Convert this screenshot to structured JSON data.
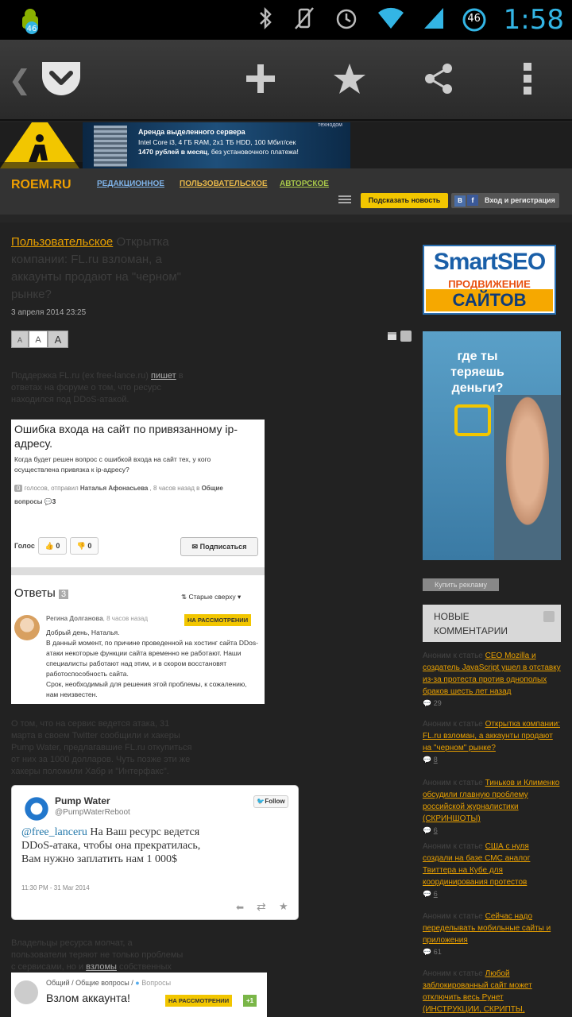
{
  "status_bar": {
    "time": "1:58",
    "battery_level": "46",
    "notification_badge": "46",
    "icons": [
      "android-notification-icon",
      "bluetooth-icon",
      "vibrate-off-icon",
      "alarm-icon",
      "wifi-icon",
      "signal-icon",
      "battery-icon"
    ]
  },
  "action_bar": {
    "icons": [
      "back-chevron-icon",
      "pocket-logo-icon",
      "add-icon",
      "star-icon",
      "share-icon",
      "overflow-menu-icon"
    ]
  },
  "ad_banner": {
    "brand": "технодом",
    "line1": "Аренда выделенного сервера",
    "line2": "Intel Core i3, 4 ГБ RAM, 2x1 ТБ HDD, 100 Мбит/сек",
    "line3_bold": "1470 рублей в месяц",
    "line3_rest": ", без установочного платежа!"
  },
  "site_header": {
    "logo": "ROEM.RU",
    "nav": [
      "РЕДАКЦИОННОЕ",
      "ПОЛЬЗОВАТЕЛЬСКОЕ",
      "АВТОРСКОЕ"
    ],
    "suggest_button": "Подсказать новость",
    "login_button": "Вход и регистрация",
    "vk": "В",
    "fb": "f"
  },
  "article": {
    "category": "Пользовательское",
    "title": "Открытка компании: FL.ru взломан, а аккаунты продают на \"черном\" рынке?",
    "date": "3 апреля 2014 23:25",
    "font_sizes": [
      "A",
      "A",
      "A"
    ],
    "para1_a": "Поддержка FL.ru (ex free-lance.ru) ",
    "para1_link": "пишет",
    "para1_b": " в ответах на форуме о том, что ресурс находился под DDoS-атакой.",
    "para2": "О том, что на сервис ведется атака, 31 марта в своем Twitter сообщили и хакеры Pump Water, предлагавшие FL.ru откупиться от них за 1000 долларов. Чуть позже эти же хакеры положили Хабр и \"Интерфакс\".",
    "para3_a": "Владельцы ресурса молчат, а пользователи теряют не только проблемы с сервисами, но и ",
    "para3_link": "взломы",
    "para3_b": " собственных аккаунтов"
  },
  "forum_card": {
    "question_title": "Ошибка входа на сайт по привязанному ip-адресу.",
    "question_body": "Когда будет решен вопрос с ошибкой входа на сайт тех, у кого осуществлена привязка к ip-адресу?",
    "votes": "0",
    "meta_a": " голосов, отправил ",
    "author": "Наталья Афонасьева",
    "meta_b": " , 8 часов назад в ",
    "category": "Общие вопросы",
    "comments": "3",
    "vote_label": "Голос",
    "up_count": "0",
    "down_count": "0",
    "subscribe_button": "Подписаться",
    "answers_label": "Ответы",
    "answers_count": "3",
    "sort_label": "Старые сверху",
    "reply_author": "Регина Долганова",
    "reply_time": ", 8 часов назад",
    "reply_badge": "НА РАССМОТРЕНИИ",
    "reply_text": "Добрый день, Наталья.\nВ данный момент, по причине проведенной на хостинг сайта DDos-атаки некоторые функции сайта временно не работают. Наши специалисты работают над этим, и в скором восстановят работоспособность сайта.\nСрок, необходимый для решения этой проблемы, к сожалению, нам неизвестен."
  },
  "tweet": {
    "name": "Pump Water",
    "handle": "@PumpWaterReboot",
    "follow": "Follow",
    "mention": "@free_lanceru",
    "text": " На Ваш ресурс ведется DDoS-атака, чтобы она прекратилась, Вам нужно заплатить нам 1 000$",
    "time": "11:30 PM - 31 Mar 2014"
  },
  "forum_card2": {
    "crumb1": "Общий",
    "crumb2": "Общие вопросы",
    "crumb3": "Вопросы",
    "title": "Взлом аккаунта!",
    "badge": "НА РАССМОТРЕНИИ",
    "plus": "+1"
  },
  "sidebar": {
    "ad1_line1": "SmartSEO",
    "ad1_line2": "ПРОДВИЖЕНИЕ",
    "ad1_line3": "САЙТОВ",
    "ad2_text": "где ты теряешь деньги?",
    "buy_ad": "Купить рекламу",
    "comments_header": "НОВЫЕ КОММЕНТАРИИ",
    "comments": [
      {
        "author": "Аноним",
        "prefix": " к статье ",
        "title": "CEO Mozilla и создатель JavaScript ушел в отставку из-за протеста против однополых браков шесть лет назад",
        "count": "29"
      },
      {
        "author": "Аноним",
        "prefix": " к статье ",
        "title": "Открытка компании: FL.ru взломан, а аккаунты продают на \"черном\" рынке?",
        "count": "8"
      },
      {
        "author": "Аноним",
        "prefix": " к статье ",
        "title": "Тиньков и Клименко обсудили главную проблему российской журналистики (СКРИНШОТЫ)",
        "count": "6"
      },
      {
        "author": "Аноним",
        "prefix": " к статье ",
        "title": "США с нуля создали на базе СМС аналог Твиттера на Кубе для координирования протестов",
        "count": "6"
      },
      {
        "author": "Аноним",
        "prefix": " к статье ",
        "title": "Сейчас надо переделывать мобильные сайты и приложения",
        "count": "61"
      },
      {
        "author": "Аноним",
        "prefix": " к статье ",
        "title": "Любой заблокированный сайт может отключить весь Рунет (ИНСТРУКЦИИ, СКРИПТЫ, ИДИТЫЕ ПРОКСИ) (+комментарий",
        "count": ""
      }
    ]
  },
  "colors": {
    "accent_orange": "#f0a000",
    "holo_blue": "#33b5e5",
    "yellow": "#f2c600"
  }
}
